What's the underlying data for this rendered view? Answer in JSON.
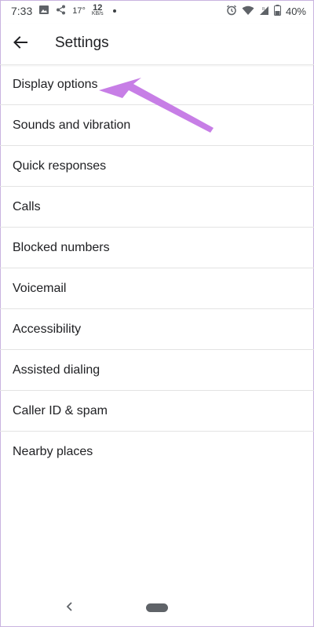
{
  "status_bar": {
    "time": "7:33",
    "temperature": "17°",
    "speed_value": "12",
    "speed_unit": "KB/s",
    "battery": "40%",
    "icons": [
      "image-icon",
      "share-icon",
      "alarm-icon",
      "wifi-icon",
      "signal-icon",
      "battery-icon"
    ]
  },
  "app_bar": {
    "title": "Settings",
    "back_icon": "arrow-left-icon"
  },
  "settings": {
    "items": [
      {
        "label": "Display options"
      },
      {
        "label": "Sounds and vibration"
      },
      {
        "label": "Quick responses"
      },
      {
        "label": "Calls"
      },
      {
        "label": "Blocked numbers"
      },
      {
        "label": "Voicemail"
      },
      {
        "label": "Accessibility"
      },
      {
        "label": "Assisted dialing"
      },
      {
        "label": "Caller ID & spam"
      },
      {
        "label": "Nearby places"
      }
    ]
  },
  "annotation": {
    "arrow_color": "#c77ee6",
    "target": "Display options"
  },
  "nav_bar": {
    "back_icon": "chevron-left-icon",
    "home_icon": "home-pill-icon"
  }
}
